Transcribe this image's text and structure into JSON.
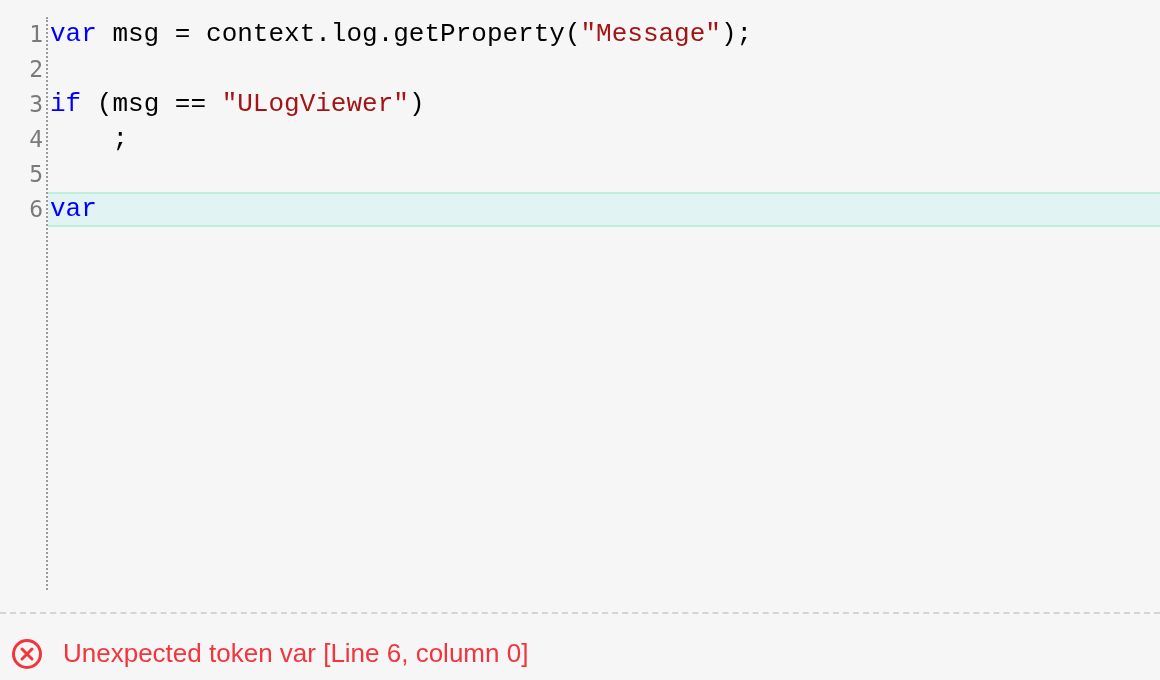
{
  "editor": {
    "lines": [
      {
        "number": "1",
        "current": false,
        "tokens": [
          {
            "kind": "keyword",
            "text": "var"
          },
          {
            "kind": "plain",
            "text": " msg = context.log.getProperty("
          },
          {
            "kind": "string",
            "text": "\"Message\""
          },
          {
            "kind": "plain",
            "text": ");"
          }
        ]
      },
      {
        "number": "2",
        "current": false
      },
      {
        "number": "3",
        "current": false,
        "tokens": [
          {
            "kind": "keyword",
            "text": "if"
          },
          {
            "kind": "plain",
            "text": " (msg == "
          },
          {
            "kind": "string",
            "text": "\"ULogViewer\""
          },
          {
            "kind": "plain",
            "text": ")"
          }
        ]
      },
      {
        "number": "4",
        "current": false,
        "tokens": [
          {
            "kind": "plain",
            "text": "    ;"
          }
        ]
      },
      {
        "number": "5",
        "current": false
      },
      {
        "number": "6",
        "current": true,
        "tokens": [
          {
            "kind": "keyword",
            "text": "var"
          }
        ]
      }
    ]
  },
  "error": {
    "message": "Unexpected token var [Line 6, column 0]"
  }
}
